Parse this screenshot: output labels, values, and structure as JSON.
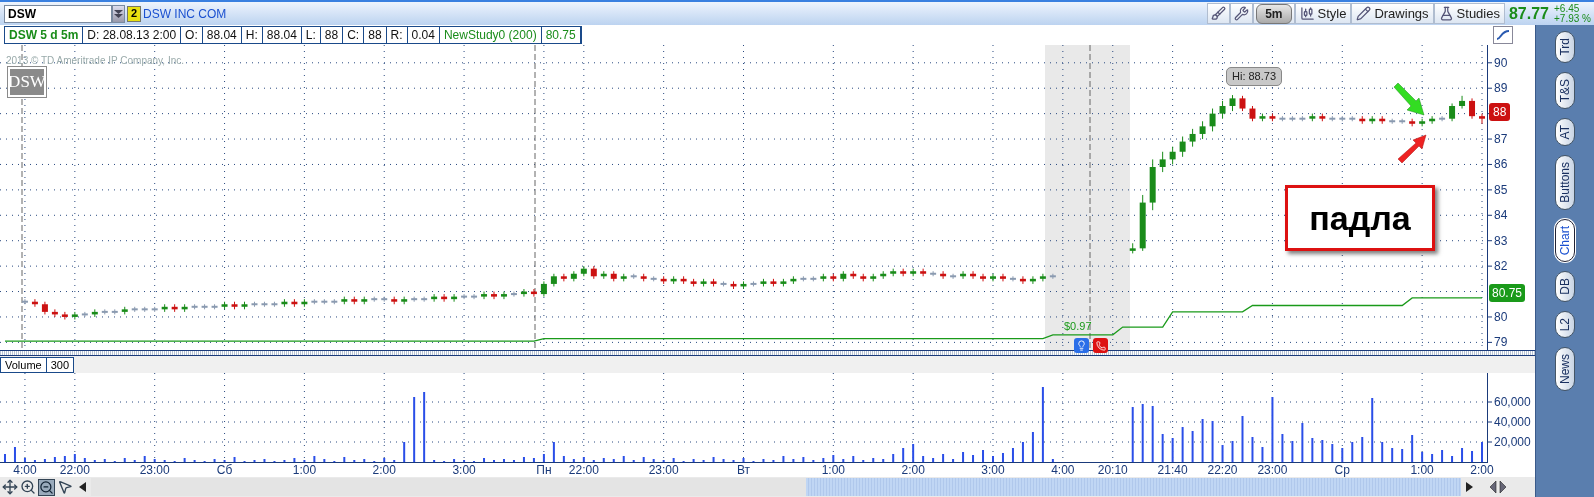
{
  "header": {
    "symbol": "DSW",
    "badge": "2",
    "company": "DSW INC COM",
    "tools": [
      {
        "kind": "icon"
      },
      {
        "kind": "icon"
      },
      {
        "kind": "interval",
        "label": "5m"
      },
      {
        "kind": "labeled",
        "label": "Style"
      },
      {
        "kind": "labeled",
        "label": "Drawings"
      },
      {
        "kind": "labeled",
        "label": "Studies"
      }
    ],
    "last": "87.77",
    "change": "+6.45",
    "change_pct": "+7.93 %"
  },
  "info": [
    {
      "kind": "title",
      "text": "DSW 5 d 5m"
    },
    {
      "kind": "plain",
      "text": "D: 28.08.13 2:00"
    },
    {
      "kind": "plain",
      "text": "O:"
    },
    {
      "kind": "plain",
      "text": "88.04"
    },
    {
      "kind": "plain",
      "text": "H:"
    },
    {
      "kind": "plain",
      "text": "88.04"
    },
    {
      "kind": "plain",
      "text": "L:"
    },
    {
      "kind": "plain",
      "text": "88"
    },
    {
      "kind": "plain",
      "text": "C:"
    },
    {
      "kind": "plain",
      "text": "88"
    },
    {
      "kind": "plain",
      "text": "R:"
    },
    {
      "kind": "plain",
      "text": "0.04"
    },
    {
      "kind": "study",
      "text": "NewStudy0 (200)"
    },
    {
      "kind": "study",
      "text": "80.75"
    }
  ],
  "watermark": "2013 © TD Ameritrade IP Company, Inc.",
  "logo": "DSW",
  "price_panel": {
    "hi_label": "Hi: 88.73",
    "last_badge": "88",
    "study_badge": "80.75",
    "dividend": "$0.97",
    "chart_data": {
      "type": "candlestick",
      "grid": true,
      "ylim": [
        78.7,
        90.7
      ],
      "yticks": [
        79,
        80,
        82,
        83,
        84,
        85,
        86,
        87,
        88,
        89,
        90
      ],
      "categories": [
        null,
        null,
        null,
        null,
        null,
        null,
        null,
        null,
        null,
        null,
        null,
        null,
        null,
        null,
        null,
        null,
        null,
        null,
        null,
        null,
        null,
        null,
        null,
        null,
        null,
        null,
        null,
        null,
        null,
        null,
        null,
        null,
        null,
        null,
        null,
        null,
        null,
        null,
        null,
        null,
        null,
        null,
        null,
        null,
        null,
        null,
        null,
        null,
        null,
        null,
        null,
        null,
        null,
        null,
        null,
        null,
        null,
        null,
        null,
        null,
        null,
        null,
        null,
        null,
        null,
        null,
        null,
        null,
        null,
        null,
        null,
        null,
        null,
        null,
        null,
        null,
        null,
        null,
        null,
        null,
        null,
        null,
        null,
        null,
        null,
        null,
        null,
        null,
        null,
        null,
        null,
        null,
        null,
        null,
        null,
        null,
        null,
        null,
        null,
        null,
        null,
        null,
        null,
        null,
        null,
        null,
        null,
        null,
        null,
        null,
        null,
        null,
        null,
        null,
        null,
        null,
        null,
        null,
        null,
        null,
        null,
        null,
        null,
        null,
        null,
        null,
        null,
        null,
        null,
        null,
        null,
        null,
        null,
        null,
        null,
        null,
        null,
        null,
        null,
        null,
        null,
        null,
        null,
        null,
        null,
        null,
        null,
        null,
        null
      ],
      "ohlc": [
        null,
        null,
        [
          80.6,
          80.7,
          80.5,
          80.6
        ],
        [
          80.6,
          80.7,
          80.4,
          80.5
        ],
        [
          80.5,
          80.6,
          80.1,
          80.2
        ],
        [
          80.2,
          80.3,
          80.0,
          80.1
        ],
        [
          80.1,
          80.2,
          79.9,
          80.0
        ],
        [
          80.0,
          80.2,
          79.9,
          80.1
        ],
        [
          80.1,
          80.2,
          80.0,
          80.1
        ],
        [
          80.1,
          80.3,
          80.0,
          80.2
        ],
        [
          80.2,
          80.3,
          80.1,
          80.2
        ],
        [
          80.2,
          80.3,
          80.1,
          80.2
        ],
        [
          80.2,
          80.4,
          80.1,
          80.3
        ],
        [
          80.3,
          80.4,
          80.2,
          80.3
        ],
        [
          80.3,
          80.4,
          80.2,
          80.3
        ],
        [
          80.3,
          80.4,
          80.2,
          80.3
        ],
        [
          80.3,
          80.5,
          80.2,
          80.4
        ],
        [
          80.4,
          80.5,
          80.2,
          80.3
        ],
        [
          80.3,
          80.5,
          80.2,
          80.4
        ],
        [
          80.4,
          80.5,
          80.3,
          80.4
        ],
        [
          80.4,
          80.5,
          80.3,
          80.4
        ],
        [
          80.4,
          80.5,
          80.3,
          80.4
        ],
        [
          80.4,
          80.6,
          80.3,
          80.5
        ],
        [
          80.5,
          80.6,
          80.3,
          80.4
        ],
        [
          80.4,
          80.6,
          80.3,
          80.5
        ],
        [
          80.5,
          80.6,
          80.4,
          80.5
        ],
        [
          80.5,
          80.6,
          80.4,
          80.5
        ],
        [
          80.5,
          80.6,
          80.4,
          80.5
        ],
        [
          80.5,
          80.7,
          80.4,
          80.6
        ],
        [
          80.6,
          80.7,
          80.4,
          80.5
        ],
        [
          80.5,
          80.7,
          80.4,
          80.6
        ],
        [
          80.6,
          80.7,
          80.5,
          80.6
        ],
        [
          80.6,
          80.7,
          80.5,
          80.6
        ],
        [
          80.6,
          80.7,
          80.5,
          80.6
        ],
        [
          80.6,
          80.8,
          80.5,
          80.7
        ],
        [
          80.7,
          80.8,
          80.5,
          80.6
        ],
        [
          80.6,
          80.8,
          80.5,
          80.7
        ],
        [
          80.7,
          80.8,
          80.6,
          80.7
        ],
        [
          80.7,
          80.8,
          80.6,
          80.7
        ],
        [
          80.7,
          80.8,
          80.5,
          80.6
        ],
        [
          80.6,
          80.8,
          80.5,
          80.7
        ],
        [
          80.7,
          80.8,
          80.6,
          80.7
        ],
        [
          80.7,
          80.8,
          80.6,
          80.7
        ],
        [
          80.7,
          80.9,
          80.6,
          80.8
        ],
        [
          80.8,
          80.9,
          80.6,
          80.7
        ],
        [
          80.7,
          80.9,
          80.6,
          80.8
        ],
        [
          80.8,
          80.9,
          80.7,
          80.8
        ],
        [
          80.8,
          80.9,
          80.7,
          80.8
        ],
        [
          80.8,
          81.0,
          80.7,
          80.9
        ],
        [
          80.9,
          81.0,
          80.7,
          80.8
        ],
        [
          80.8,
          81.0,
          80.7,
          80.9
        ],
        [
          80.9,
          81.0,
          80.8,
          80.9
        ],
        [
          80.9,
          81.1,
          80.8,
          81.0
        ],
        [
          81.0,
          81.1,
          80.8,
          80.9
        ],
        [
          80.9,
          81.4,
          80.8,
          81.3
        ],
        [
          81.3,
          81.7,
          81.2,
          81.6
        ],
        [
          81.6,
          81.7,
          81.4,
          81.5
        ],
        [
          81.5,
          81.8,
          81.4,
          81.7
        ],
        [
          81.7,
          82.0,
          81.6,
          81.9
        ],
        [
          81.9,
          82.0,
          81.5,
          81.6
        ],
        [
          81.6,
          81.8,
          81.5,
          81.7
        ],
        [
          81.7,
          81.8,
          81.4,
          81.5
        ],
        [
          81.5,
          81.7,
          81.4,
          81.6
        ],
        [
          81.6,
          81.7,
          81.5,
          81.6
        ],
        [
          81.6,
          81.7,
          81.4,
          81.5
        ],
        [
          81.5,
          81.6,
          81.4,
          81.5
        ],
        [
          81.5,
          81.6,
          81.3,
          81.4
        ],
        [
          81.4,
          81.6,
          81.3,
          81.5
        ],
        [
          81.5,
          81.6,
          81.3,
          81.4
        ],
        [
          81.4,
          81.5,
          81.2,
          81.3
        ],
        [
          81.3,
          81.5,
          81.2,
          81.4
        ],
        [
          81.4,
          81.5,
          81.2,
          81.3
        ],
        [
          81.3,
          81.4,
          81.2,
          81.3
        ],
        [
          81.3,
          81.4,
          81.1,
          81.2
        ],
        [
          81.2,
          81.4,
          81.1,
          81.3
        ],
        [
          81.3,
          81.4,
          81.2,
          81.3
        ],
        [
          81.3,
          81.5,
          81.2,
          81.4
        ],
        [
          81.4,
          81.5,
          81.2,
          81.3
        ],
        [
          81.3,
          81.5,
          81.2,
          81.4
        ],
        [
          81.4,
          81.6,
          81.3,
          81.5
        ],
        [
          81.5,
          81.6,
          81.4,
          81.5
        ],
        [
          81.5,
          81.6,
          81.4,
          81.5
        ],
        [
          81.5,
          81.7,
          81.4,
          81.6
        ],
        [
          81.6,
          81.7,
          81.4,
          81.5
        ],
        [
          81.5,
          81.8,
          81.4,
          81.7
        ],
        [
          81.7,
          81.8,
          81.5,
          81.6
        ],
        [
          81.6,
          81.7,
          81.4,
          81.5
        ],
        [
          81.5,
          81.7,
          81.4,
          81.6
        ],
        [
          81.6,
          81.8,
          81.5,
          81.7
        ],
        [
          81.7,
          81.9,
          81.6,
          81.8
        ],
        [
          81.8,
          81.9,
          81.6,
          81.7
        ],
        [
          81.7,
          81.9,
          81.6,
          81.8
        ],
        [
          81.8,
          81.9,
          81.6,
          81.7
        ],
        [
          81.7,
          81.8,
          81.6,
          81.7
        ],
        [
          81.7,
          81.8,
          81.5,
          81.6
        ],
        [
          81.6,
          81.7,
          81.5,
          81.6
        ],
        [
          81.6,
          81.8,
          81.5,
          81.7
        ],
        [
          81.7,
          81.8,
          81.5,
          81.6
        ],
        [
          81.6,
          81.7,
          81.4,
          81.5
        ],
        [
          81.5,
          81.7,
          81.4,
          81.6
        ],
        [
          81.6,
          81.7,
          81.4,
          81.5
        ],
        [
          81.5,
          81.6,
          81.4,
          81.5
        ],
        [
          81.5,
          81.6,
          81.3,
          81.4
        ],
        [
          81.4,
          81.6,
          81.3,
          81.5
        ],
        [
          81.5,
          81.7,
          81.4,
          81.6
        ],
        [
          81.6,
          81.7,
          81.5,
          81.6
        ],
        null,
        null,
        null,
        null,
        null,
        null,
        null,
        [
          82.6,
          82.9,
          82.5,
          82.7
        ],
        [
          82.7,
          84.8,
          82.6,
          84.5
        ],
        [
          84.5,
          86.2,
          84.2,
          85.9
        ],
        [
          85.9,
          86.5,
          85.7,
          86.2
        ],
        [
          86.2,
          86.7,
          86.0,
          86.5
        ],
        [
          86.5,
          87.1,
          86.3,
          86.9
        ],
        [
          86.9,
          87.4,
          86.7,
          87.2
        ],
        [
          87.2,
          87.7,
          87.0,
          87.5
        ],
        [
          87.5,
          88.2,
          87.3,
          88.0
        ],
        [
          88.0,
          88.5,
          87.8,
          88.3
        ],
        [
          88.3,
          88.73,
          88.1,
          88.6
        ],
        [
          88.6,
          88.7,
          88.1,
          88.2
        ],
        [
          88.2,
          88.3,
          87.7,
          87.8
        ],
        [
          87.8,
          88.0,
          87.7,
          87.9
        ],
        [
          87.9,
          88.0,
          87.7,
          87.8
        ],
        [
          87.8,
          87.9,
          87.7,
          87.8
        ],
        [
          87.8,
          87.9,
          87.7,
          87.8
        ],
        [
          87.8,
          87.9,
          87.7,
          87.8
        ],
        [
          87.8,
          88.0,
          87.7,
          87.9
        ],
        [
          87.9,
          88.0,
          87.7,
          87.8
        ],
        [
          87.8,
          87.9,
          87.7,
          87.8
        ],
        [
          87.8,
          87.9,
          87.7,
          87.8
        ],
        [
          87.8,
          87.9,
          87.7,
          87.8
        ],
        [
          87.8,
          87.9,
          87.6,
          87.7
        ],
        [
          87.7,
          87.9,
          87.6,
          87.8
        ],
        [
          87.8,
          87.9,
          87.6,
          87.7
        ],
        [
          87.7,
          87.8,
          87.6,
          87.7
        ],
        [
          87.7,
          87.8,
          87.6,
          87.7
        ],
        [
          87.7,
          87.8,
          87.5,
          87.6
        ],
        [
          87.6,
          87.8,
          87.5,
          87.7
        ],
        [
          87.7,
          87.9,
          87.6,
          87.8
        ],
        [
          87.8,
          87.9,
          87.7,
          87.8
        ],
        [
          87.8,
          88.4,
          87.7,
          88.3
        ],
        [
          88.3,
          88.7,
          88.2,
          88.5
        ],
        [
          88.5,
          88.6,
          87.8,
          87.9
        ],
        [
          87.9,
          88.0,
          87.6,
          87.8
        ]
      ],
      "series": [
        {
          "type": "line",
          "color": "#1a9a1a",
          "values": [
            79.05,
            79.05,
            79.05,
            79.05,
            79.05,
            79.05,
            79.05,
            79.05,
            79.05,
            79.05,
            79.05,
            79.05,
            79.05,
            79.05,
            79.05,
            79.05,
            79.05,
            79.05,
            79.05,
            79.05,
            79.05,
            79.05,
            79.05,
            79.05,
            79.05,
            79.05,
            79.05,
            79.05,
            79.05,
            79.05,
            79.05,
            79.05,
            79.05,
            79.05,
            79.05,
            79.05,
            79.05,
            79.05,
            79.05,
            79.05,
            79.05,
            79.05,
            79.05,
            79.05,
            79.05,
            79.05,
            79.05,
            79.05,
            79.05,
            79.05,
            79.05,
            79.05,
            79.05,
            79.05,
            79.15,
            79.15,
            79.15,
            79.15,
            79.15,
            79.15,
            79.15,
            79.15,
            79.15,
            79.15,
            79.15,
            79.15,
            79.15,
            79.15,
            79.15,
            79.15,
            79.15,
            79.15,
            79.15,
            79.15,
            79.15,
            79.15,
            79.15,
            79.15,
            79.15,
            79.15,
            79.15,
            79.15,
            79.15,
            79.15,
            79.15,
            79.15,
            79.15,
            79.15,
            79.15,
            79.15,
            79.15,
            79.15,
            79.15,
            79.15,
            79.15,
            79.15,
            79.15,
            79.15,
            79.15,
            79.15,
            79.15,
            79.15,
            79.15,
            79.15,
            79.15,
            79.3,
            79.3,
            79.3,
            79.3,
            79.3,
            79.3,
            79.3,
            79.6,
            79.6,
            79.6,
            79.6,
            79.6,
            80.2,
            80.2,
            80.2,
            80.2,
            80.2,
            80.2,
            80.2,
            80.2,
            80.45,
            80.45,
            80.45,
            80.45,
            80.45,
            80.45,
            80.45,
            80.45,
            80.45,
            80.45,
            80.45,
            80.45,
            80.45,
            80.45,
            80.45,
            80.45,
            80.75,
            80.75,
            80.75,
            80.75,
            80.75,
            80.75,
            80.75,
            80.75
          ]
        }
      ]
    }
  },
  "annotation": "падла",
  "volume_panel": {
    "period": "300",
    "chart_data": {
      "type": "bar",
      "grid": true,
      "ylim": [
        0,
        89000
      ],
      "categories": [
        null,
        null,
        "4:00",
        null,
        null,
        null,
        null,
        "22:00",
        null,
        null,
        null,
        null,
        null,
        null,
        null,
        "23:00",
        null,
        null,
        null,
        null,
        null,
        null,
        "Сб",
        null,
        null,
        null,
        null,
        null,
        null,
        null,
        "1:00",
        null,
        null,
        null,
        null,
        null,
        null,
        null,
        "2:00",
        null,
        null,
        null,
        null,
        null,
        null,
        null,
        "3:00",
        null,
        null,
        null,
        null,
        null,
        null,
        null,
        "Пн",
        null,
        null,
        null,
        "22:00",
        null,
        null,
        null,
        null,
        null,
        null,
        null,
        "23:00",
        null,
        null,
        null,
        null,
        null,
        null,
        null,
        "Вт",
        null,
        null,
        null,
        null,
        null,
        null,
        null,
        null,
        "1:00",
        null,
        null,
        null,
        null,
        null,
        null,
        null,
        "2:00",
        null,
        null,
        null,
        null,
        null,
        null,
        null,
        "3:00",
        null,
        null,
        null,
        null,
        null,
        null,
        "4:00",
        null,
        null,
        null,
        null,
        "20:10",
        null,
        null,
        null,
        null,
        null,
        "21:40",
        null,
        null,
        null,
        null,
        "22:20",
        null,
        null,
        null,
        null,
        "23:00",
        null,
        null,
        null,
        null,
        null,
        null,
        "Ср",
        null,
        null,
        null,
        null,
        null,
        null,
        null,
        "1:00",
        null,
        null,
        null,
        null,
        null,
        "2:00"
      ],
      "yticks": [
        {
          "value": 20000,
          "label": "20,000"
        },
        {
          "value": 40000,
          "label": "40,000"
        },
        {
          "value": 60000,
          "label": "60,000"
        }
      ],
      "series": [
        {
          "name": "Volume",
          "color": "#2a4ee8",
          "values": [
            8000,
            15000,
            4000,
            2000,
            3000,
            5000,
            6000,
            8000,
            4000,
            2000,
            3000,
            1000,
            4000,
            2000,
            6000,
            3000,
            2000,
            1000,
            4000,
            2000,
            1000,
            3000,
            2000,
            5000,
            1000,
            2000,
            3000,
            1000,
            2000,
            4000,
            2000,
            6000,
            3000,
            1000,
            5000,
            2000,
            3000,
            1000,
            4000,
            2000,
            20000,
            65000,
            70000,
            2000,
            1000,
            3000,
            2000,
            1000,
            4000,
            2000,
            3000,
            2000,
            5000,
            4000,
            8000,
            20000,
            6000,
            3000,
            5000,
            2000,
            4000,
            3000,
            6000,
            2000,
            5000,
            3000,
            2000,
            4000,
            1000,
            3000,
            2000,
            5000,
            3000,
            2000,
            4000,
            1000,
            3000,
            2000,
            6000,
            3000,
            5000,
            2000,
            4000,
            7000,
            3000,
            6000,
            2000,
            4000,
            3000,
            8000,
            14000,
            18000,
            6000,
            4000,
            8000,
            3000,
            10000,
            7000,
            12000,
            6000,
            9000,
            14000,
            20000,
            30000,
            75000,
            3000,
            null,
            null,
            null,
            null,
            null,
            null,
            null,
            55000,
            58000,
            56000,
            28000,
            24000,
            35000,
            31000,
            43000,
            41000,
            17000,
            21000,
            46000,
            25000,
            15000,
            65000,
            28000,
            21000,
            39000,
            24000,
            22000,
            18000,
            14000,
            20000,
            25000,
            64000,
            20000,
            14000,
            13000,
            27000,
            10000,
            8000,
            12000,
            6000,
            14000,
            11000,
            20000
          ]
        }
      ]
    }
  },
  "side_tabs": [
    {
      "label": "Trd",
      "selected": false
    },
    {
      "label": "T&S",
      "selected": false
    },
    {
      "label": "AT",
      "selected": false
    },
    {
      "label": "Buttons",
      "selected": false
    },
    {
      "label": "Chart",
      "selected": true
    },
    {
      "label": "DB",
      "selected": false
    },
    {
      "label": "L2",
      "selected": false
    },
    {
      "label": "News",
      "selected": false
    }
  ]
}
